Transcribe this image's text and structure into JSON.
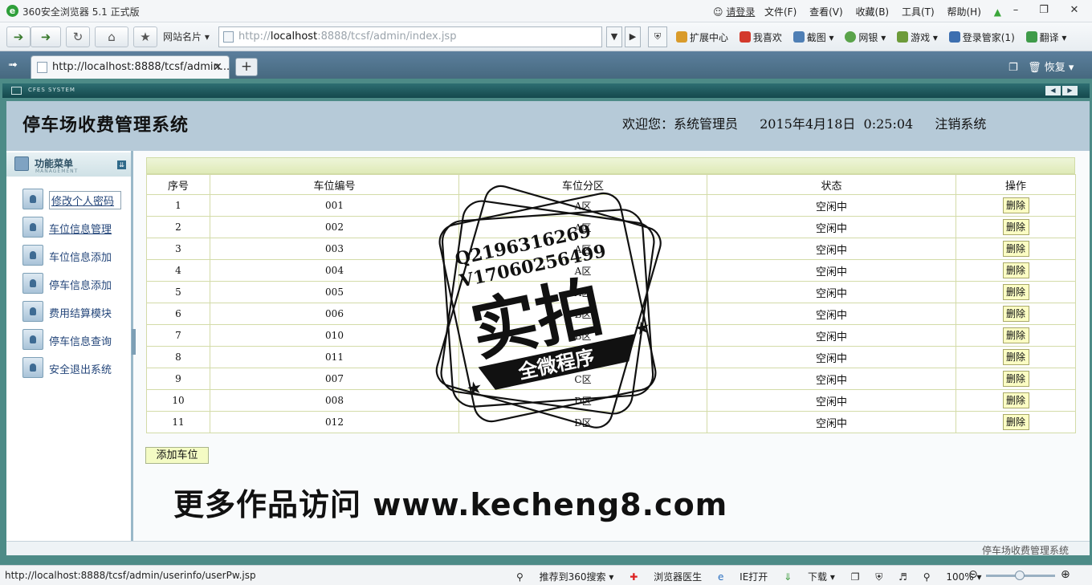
{
  "browser": {
    "title": "360安全浏览器 5.1 正式版",
    "login_label": "请登录",
    "menus": [
      "文件(F)",
      "查看(V)",
      "收藏(B)",
      "工具(T)",
      "帮助(H)"
    ],
    "site_cards": "网站名片",
    "address_scheme": "http://",
    "address_host": "localhost",
    "address_rest": ":8888/tcsf/admin/index.jsp",
    "tools": [
      "扩展中心",
      "我喜欢",
      "截图",
      "网银",
      "游戏",
      "登录管家(1)",
      "翻译"
    ],
    "tab_title": "http://localhost:8888/tcsf/admin...",
    "restore_label": "恢复"
  },
  "frame": {
    "cfes_label": "CFES SYSTEM"
  },
  "header": {
    "system_title": "停车场收费管理系统",
    "welcome": "欢迎您：系统管理员",
    "datetime": "2015年4月18日  0:25:04",
    "logout": "注销系统"
  },
  "sidebar": {
    "title": "功能菜单",
    "subtitle": "MANAGEMENT",
    "items": [
      {
        "label": "修改个人密码"
      },
      {
        "label": "车位信息管理"
      },
      {
        "label": "车位信息添加"
      },
      {
        "label": "停车信息添加"
      },
      {
        "label": "费用结算模块"
      },
      {
        "label": "停车信息查询"
      },
      {
        "label": "安全退出系统"
      }
    ]
  },
  "table": {
    "columns": [
      "序号",
      "车位编号",
      "车位分区",
      "状态",
      "操作"
    ],
    "delete_label": "删除",
    "rows": [
      {
        "no": "1",
        "code": "001",
        "zone": "A区",
        "status": "空闲中"
      },
      {
        "no": "2",
        "code": "002",
        "zone": "A区",
        "status": "空闲中"
      },
      {
        "no": "3",
        "code": "003",
        "zone": "A区",
        "status": "空闲中"
      },
      {
        "no": "4",
        "code": "004",
        "zone": "A区",
        "status": "空闲中"
      },
      {
        "no": "5",
        "code": "005",
        "zone": "A区",
        "status": "空闲中"
      },
      {
        "no": "6",
        "code": "006",
        "zone": "B区",
        "status": "空闲中"
      },
      {
        "no": "7",
        "code": "010",
        "zone": "B区",
        "status": "空闲中"
      },
      {
        "no": "8",
        "code": "011",
        "zone": "C区",
        "status": "空闲中"
      },
      {
        "no": "9",
        "code": "007",
        "zone": "C区",
        "status": "空闲中"
      },
      {
        "no": "10",
        "code": "008",
        "zone": "D区",
        "status": "空闲中"
      },
      {
        "no": "11",
        "code": "012",
        "zone": "D区",
        "status": "空闲中"
      }
    ],
    "add_button": "添加车位"
  },
  "footer": {
    "text": "停车场收费管理系统"
  },
  "statusbar": {
    "url": "http://localhost:8888/tcsf/admin/userinfo/userPw.jsp",
    "items": [
      "推荐到360搜索",
      "浏览器医生",
      "IE打开",
      "下载"
    ],
    "zoom": "100%"
  },
  "watermark": {
    "contact_q": "Q2196316269",
    "contact_v": "V17060256499",
    "stamp_big": "实拍",
    "stamp_ribbon": "全微程序",
    "site": "更多作品访问 www.kecheng8.com"
  },
  "colors": {
    "header_bg": "#b6cad8",
    "frame_teal": "#4d8b87",
    "delete_btn": "#fbfdc4",
    "table_border": "#d3dba8"
  }
}
